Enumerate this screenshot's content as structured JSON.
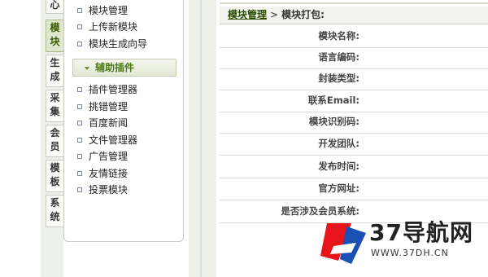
{
  "side_tabs": [
    {
      "chars": [
        "心"
      ],
      "active": false
    },
    {
      "chars": [
        "模",
        "块"
      ],
      "active": true
    },
    {
      "chars": [
        "生",
        "成"
      ],
      "active": false
    },
    {
      "chars": [
        "采",
        "集"
      ],
      "active": false
    },
    {
      "chars": [
        "会",
        "员"
      ],
      "active": false
    },
    {
      "chars": [
        "模",
        "板"
      ],
      "active": false
    },
    {
      "chars": [
        "系",
        "统"
      ],
      "active": false
    }
  ],
  "menu": {
    "top_items": [
      "模块管理",
      "上传新模块",
      "模块生成向导"
    ],
    "section_title": "辅助插件",
    "plugin_items": [
      "插件管理器",
      "挑错管理",
      "百度新闻",
      "文件管理器",
      "广告管理",
      "友情链接",
      "投票模块"
    ]
  },
  "breadcrumb": {
    "link": "模块管理",
    "separator": ">",
    "current": "模块打包:"
  },
  "form_labels": [
    "模块名称:",
    "语言编码:",
    "封装类型:",
    "联系Email:",
    "模块识别码:",
    "开发团队:",
    "发布时间:",
    "官方网址:",
    "是否涉及会员系统:"
  ],
  "watermark": {
    "logo_text": "37导航网",
    "url": "WWW.37DH.CN",
    "colors": {
      "red": "#e8141c",
      "blue": "#1a4fb3"
    }
  }
}
